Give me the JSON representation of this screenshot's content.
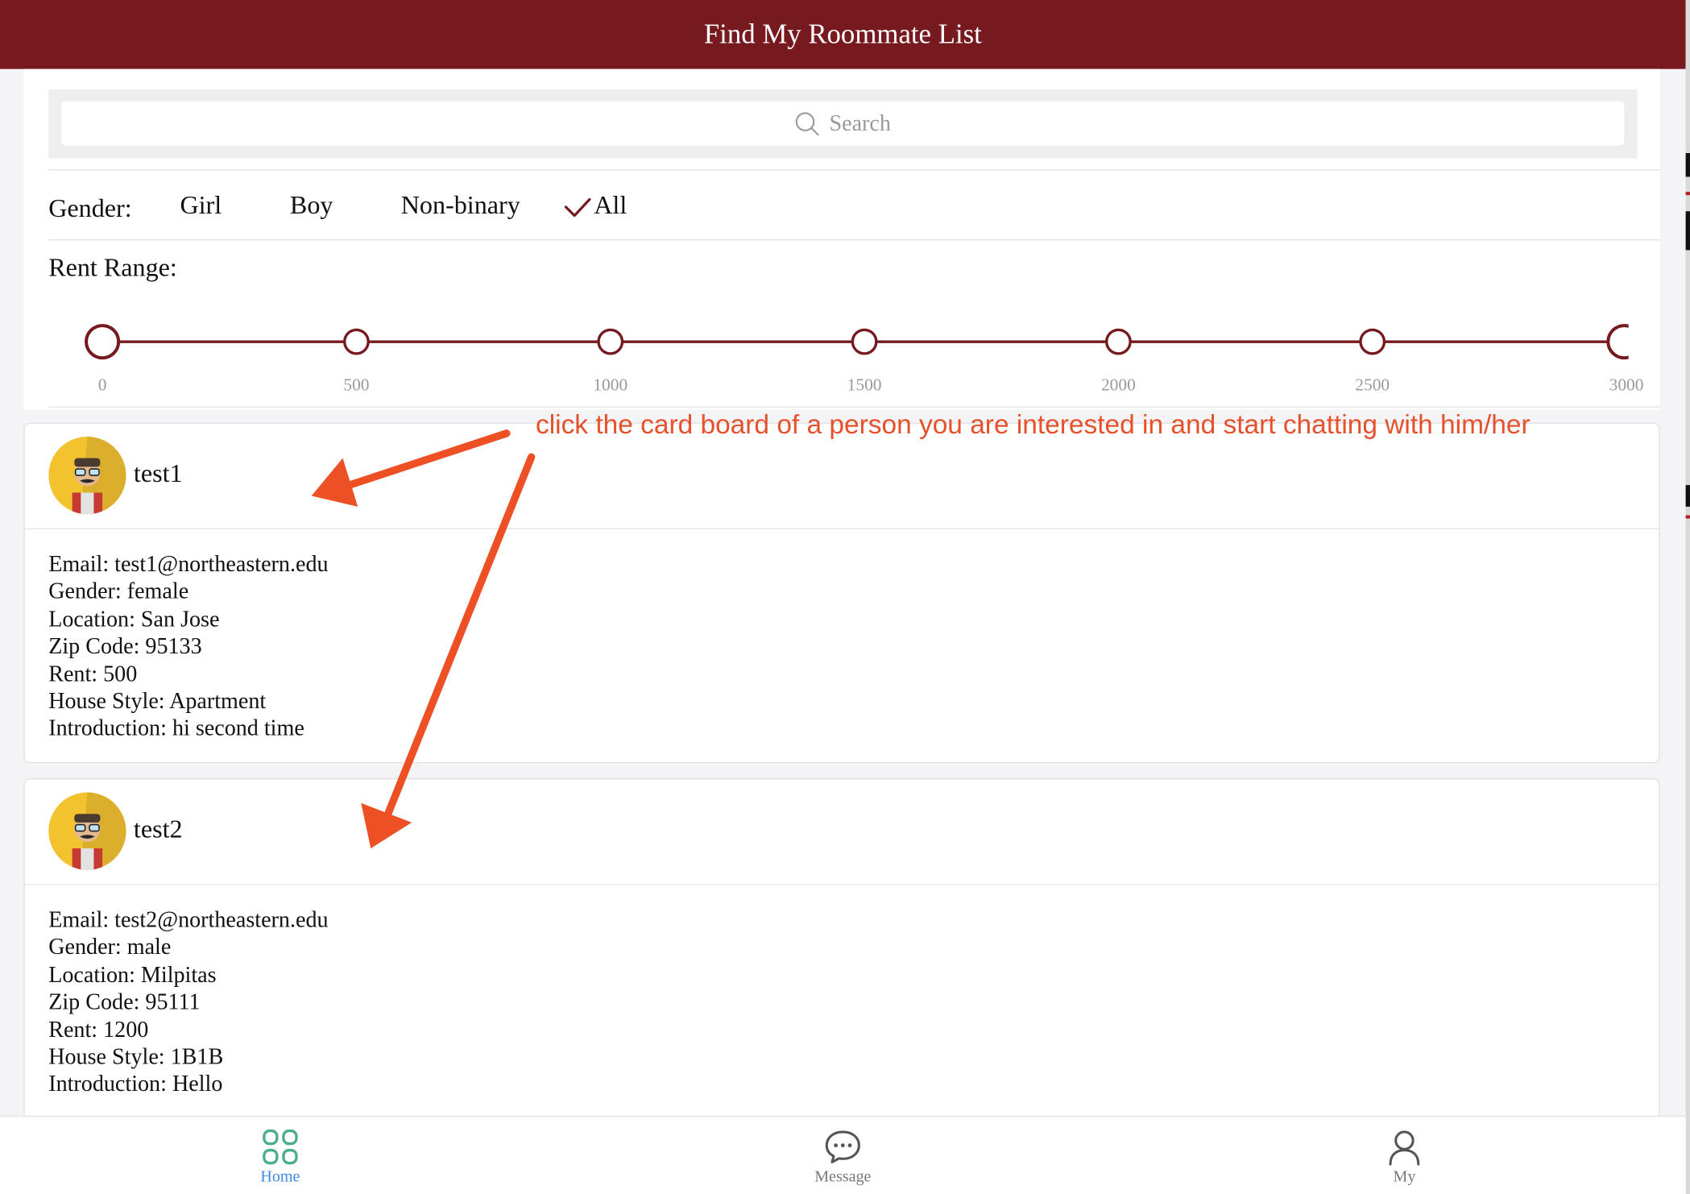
{
  "header": {
    "title": "Find My Roommate List"
  },
  "search": {
    "placeholder": "Search"
  },
  "filters": {
    "gender_label": "Gender:",
    "gender_options": [
      {
        "label": "Girl",
        "selected": false
      },
      {
        "label": "Boy",
        "selected": false
      },
      {
        "label": "Non-binary",
        "selected": false
      },
      {
        "label": "All",
        "selected": true
      }
    ],
    "rent_label": "Rent Range:",
    "rent_ticks": [
      "0",
      "500",
      "1000",
      "1500",
      "2000",
      "2500",
      "3000"
    ],
    "rent_selected": [
      0,
      3000
    ],
    "accent": "#771a1f"
  },
  "annotation": {
    "text": "click the card board of a person you are interested in and start chatting with him/her",
    "color": "#e6502a"
  },
  "cards": [
    {
      "name": "test1",
      "fields": [
        "Email: test1@northeastern.edu",
        "Gender: female",
        "Location: San Jose",
        "Zip Code: 95133",
        "Rent: 500",
        "House Style: Apartment",
        "Introduction: hi second time"
      ]
    },
    {
      "name": "test2",
      "fields": [
        "Email: test2@northeastern.edu",
        "Gender: male",
        "Location: Milpitas",
        "Zip Code: 95111",
        "Rent: 1200",
        "House Style: 1B1B",
        "Introduction: Hello"
      ]
    }
  ],
  "tabbar": {
    "tabs": [
      {
        "label": "Home",
        "icon": "grid-icon",
        "active": true
      },
      {
        "label": "Message",
        "icon": "chat-bubble-icon",
        "active": false
      },
      {
        "label": "My",
        "icon": "person-icon",
        "active": false
      }
    ]
  }
}
